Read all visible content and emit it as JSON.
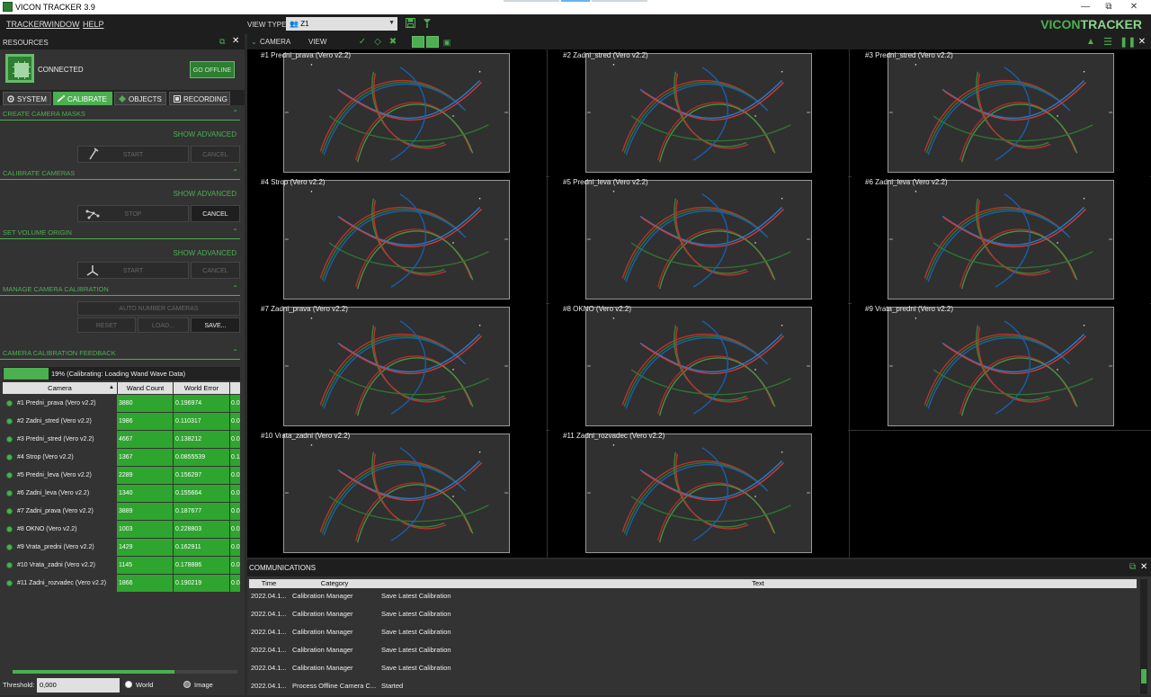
{
  "window": {
    "title": "VICON TRACKER 3.9"
  },
  "menu": {
    "tracker": "TRACKER",
    "window": "WINDOW",
    "help": "HELP",
    "view_type_label": "VIEW TYPE:",
    "view_type_value": "Z1"
  },
  "logo": {
    "part1": "VICON",
    "part2": "TRACKER"
  },
  "resources": {
    "header": "RESOURCES",
    "status": "CONNECTED",
    "go_offline": "GO OFFLINE"
  },
  "tabs": [
    {
      "label": "SYSTEM"
    },
    {
      "label": "CALIBRATE"
    },
    {
      "label": "OBJECTS"
    },
    {
      "label": "RECORDING"
    }
  ],
  "sections": {
    "masks": {
      "title": "CREATE CAMERA MASKS",
      "advanced": "SHOW ADVANCED",
      "start": "START",
      "cancel": "CANCEL"
    },
    "calib": {
      "title": "CALIBRATE CAMERAS",
      "advanced": "SHOW ADVANCED",
      "stop": "STOP",
      "cancel": "CANCEL"
    },
    "origin": {
      "title": "SET VOLUME ORIGIN",
      "advanced": "SHOW ADVANCED",
      "start": "START",
      "cancel": "CANCEL"
    },
    "manage": {
      "title": "MANAGE CAMERA CALIBRATION",
      "auto_number": "AUTO NUMBER CAMERAS",
      "reset": "RESET",
      "load": "LOAD...",
      "save": "SAVE..."
    },
    "feedback": {
      "title": "CAMERA CALIBRATION FEEDBACK"
    }
  },
  "progress": {
    "percent": 19,
    "text": "19% (Calibrating: Loading Wand Wave Data)"
  },
  "table": {
    "headers": {
      "camera": "Camera",
      "wand_count": "Wand Count",
      "world_error": "World Error"
    },
    "rows": [
      {
        "camera": "#1 Predni_prava (Vero v2.2)",
        "wand_count": "3880",
        "world_error": "0.196974",
        "extra": "0.0"
      },
      {
        "camera": "#2 Zadni_stred (Vero v2.2)",
        "wand_count": "1986",
        "world_error": "0.110317",
        "extra": "0.0"
      },
      {
        "camera": "#3 Predni_stred (Vero v2.2)",
        "wand_count": "4667",
        "world_error": "0.138212",
        "extra": "0.0"
      },
      {
        "camera": "#4 Strop (Vero v2.2)",
        "wand_count": "1367",
        "world_error": "0.0855539",
        "extra": "0.1"
      },
      {
        "camera": "#5 Predni_leva (Vero v2.2)",
        "wand_count": "2289",
        "world_error": "0.156297",
        "extra": "0.0"
      },
      {
        "camera": "#6 Zadni_leva (Vero v2.2)",
        "wand_count": "1340",
        "world_error": "0.155664",
        "extra": "0.0"
      },
      {
        "camera": "#7 Zadni_prava (Vero v2.2)",
        "wand_count": "3889",
        "world_error": "0.187677",
        "extra": "0.0"
      },
      {
        "camera": "#8 OKNO (Vero v2.2)",
        "wand_count": "1003",
        "world_error": "0.228803",
        "extra": "0.0"
      },
      {
        "camera": "#9 Vrata_predni (Vero v2.2)",
        "wand_count": "1429",
        "world_error": "0.162911",
        "extra": "0.0"
      },
      {
        "camera": "#10 Vrata_zadni (Vero v2.2)",
        "wand_count": "1145",
        "world_error": "0.178886",
        "extra": "0.0"
      },
      {
        "camera": "#11 Zadni_rozvadec (Vero v2.2)",
        "wand_count": "1866",
        "world_error": "0.190219",
        "extra": "0.0"
      }
    ]
  },
  "threshold": {
    "label": "Threshold:",
    "value": "0,000",
    "world": "World",
    "image": "Image"
  },
  "viewport": {
    "camera_label": "CAMERA",
    "view_label": "VIEW",
    "cameras": [
      "#1 Predni_prava (Vero v2.2)",
      "#2 Zadni_stred (Vero v2.2)",
      "#3 Predni_stred (Vero v2.2)",
      "#4 Strop (Vero v2.2)",
      "#5 Predni_leva (Vero v2.2)",
      "#6 Zadni_leva (Vero v2.2)",
      "#7 Zadni_prava (Vero v2.2)",
      "#8 OKNO (Vero v2.2)",
      "#9 Vrata_predni (Vero v2.2)",
      "#10 Vrata_zadni (Vero v2.2)",
      "#11 Zadni_rozvadec (Vero v2.2)"
    ]
  },
  "communications": {
    "title": "COMMUNICATIONS",
    "headers": {
      "time": "Time",
      "category": "Category",
      "text": "Text"
    },
    "rows": [
      {
        "time": "2022.04.1...",
        "category": "Calibration Manager",
        "text": "Save Latest Calibration"
      },
      {
        "time": "2022.04.1...",
        "category": "Calibration Manager",
        "text": "Save Latest Calibration"
      },
      {
        "time": "2022.04.1...",
        "category": "Calibration Manager",
        "text": "Save Latest Calibration"
      },
      {
        "time": "2022.04.1...",
        "category": "Calibration Manager",
        "text": "Save Latest Calibration"
      },
      {
        "time": "2022.04.1...",
        "category": "Calibration Manager",
        "text": "Save Latest Calibration"
      },
      {
        "time": "2022.04.1...",
        "category": "Process Offline Camera C...",
        "text": "Started"
      }
    ]
  },
  "colors": {
    "accent": "#4caf50",
    "panel": "#333333",
    "dark": "#1e1e1e"
  }
}
